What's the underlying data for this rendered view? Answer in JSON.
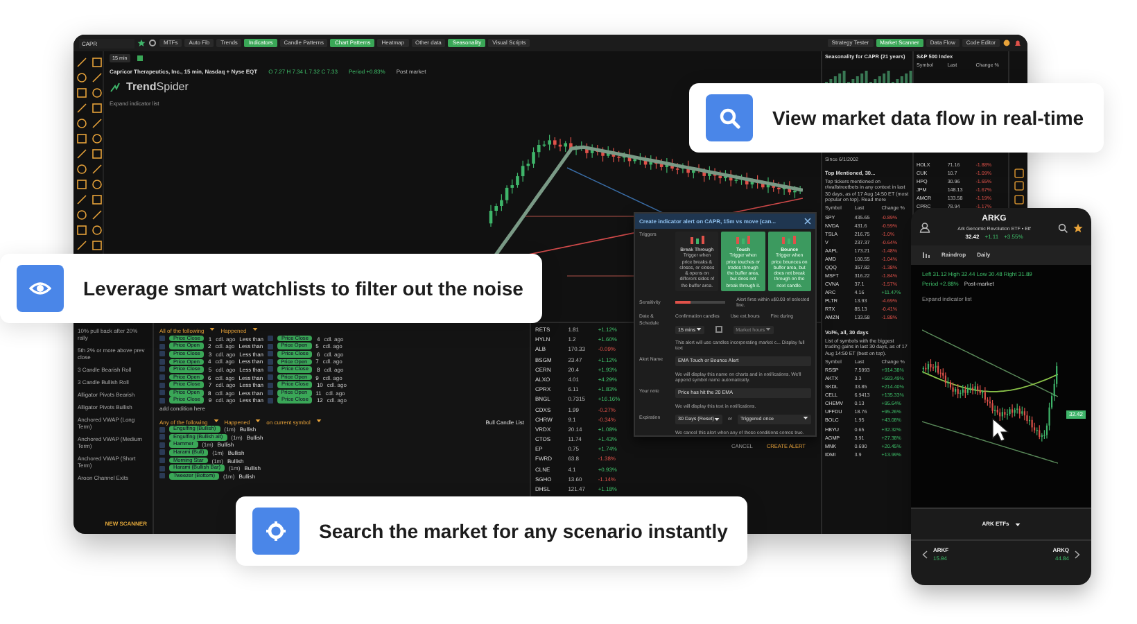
{
  "desktop": {
    "toolbar": {
      "symbol": "CAPR",
      "left_buttons": [
        {
          "label": "MTFs",
          "on": false
        },
        {
          "label": "Auto Fib",
          "on": false
        },
        {
          "label": "Trends",
          "on": false
        },
        {
          "label": "Indicators",
          "on": true
        },
        {
          "label": "Candle Patterns",
          "on": false
        },
        {
          "label": "Chart Patterns",
          "on": true
        },
        {
          "label": "Heatmap",
          "on": false
        },
        {
          "label": "Other data",
          "on": false
        },
        {
          "label": "Seasonality",
          "on": true
        },
        {
          "label": "Visual Scripts",
          "on": false
        }
      ],
      "right_buttons": [
        {
          "label": "Strategy Tester",
          "on": false
        },
        {
          "label": "Market Scanner",
          "on": true
        },
        {
          "label": "Data Flow",
          "on": false
        },
        {
          "label": "Code Editor",
          "on": false
        }
      ]
    },
    "chart": {
      "timeframe": "15 min",
      "title": "Capricor Therapeutics, Inc., 15 min, Nasdaq + Nyse EQT",
      "ohlc": "O 7.27  H 7.34  L 7.32  C 7.33",
      "period": "Period +0.83%",
      "session": "Post market",
      "logo": "**Trend**Spider",
      "expand_link": "Expand indicator list"
    },
    "scanner_list": [
      {
        "title": "10% pull back after 20% rally"
      },
      {
        "title": "5th 2% or more above prev close"
      },
      {
        "title": "3 Candle Bearish Roll"
      },
      {
        "title": "3 Candle Bullish Roll"
      },
      {
        "title": "Alligator Pivots Bearish"
      },
      {
        "title": "Alligator Pivots Bullish"
      },
      {
        "title": "Anchored VWAP (Long Term)"
      },
      {
        "title": "Anchored VWAP (Medium Term)"
      },
      {
        "title": "Anchored VWAP (Short Term)"
      },
      {
        "title": "Aroon Channel Exits"
      }
    ],
    "new_scanner": "NEW SCANNER",
    "scanner": {
      "group1": {
        "mode": "All of the following",
        "when": "Happened"
      },
      "conditions": [
        {
          "a": "Price Close",
          "a_n": "1",
          "a_ago": "cdl. ago",
          "op": "Less than",
          "b": "Price Close",
          "b_n": "4",
          "b_ago": "cdl. ago"
        },
        {
          "a": "Price Open",
          "a_n": "2",
          "a_ago": "cdl. ago",
          "op": "Less than",
          "b": "Price Open",
          "b_n": "5",
          "b_ago": "cdl. ago"
        },
        {
          "a": "Price Close",
          "a_n": "3",
          "a_ago": "cdl. ago",
          "op": "Less than",
          "b": "Price Close",
          "b_n": "6",
          "b_ago": "cdl. ago"
        },
        {
          "a": "Price Open",
          "a_n": "4",
          "a_ago": "cdl. ago",
          "op": "Less than",
          "b": "Price Open",
          "b_n": "7",
          "b_ago": "cdl. ago"
        },
        {
          "a": "Price Close",
          "a_n": "5",
          "a_ago": "cdl. ago",
          "op": "Less than",
          "b": "Price Close",
          "b_n": "8",
          "b_ago": "cdl. ago"
        },
        {
          "a": "Price Open",
          "a_n": "6",
          "a_ago": "cdl. ago",
          "op": "Less than",
          "b": "Price Open",
          "b_n": "9",
          "b_ago": "cdl. ago"
        },
        {
          "a": "Price Close",
          "a_n": "7",
          "a_ago": "cdl. ago",
          "op": "Less than",
          "b": "Price Close",
          "b_n": "10",
          "b_ago": "cdl. ago"
        },
        {
          "a": "Price Open",
          "a_n": "8",
          "a_ago": "cdl. ago",
          "op": "Less than",
          "b": "Price Open",
          "b_n": "11",
          "b_ago": "cdl. ago"
        },
        {
          "a": "Price Close",
          "a_n": "9",
          "a_ago": "cdl. ago",
          "op": "Less than",
          "b": "Price Close",
          "b_n": "12",
          "b_ago": "cdl. ago"
        }
      ],
      "add_condition": "add condition here",
      "group2": {
        "mode": "Any of the following",
        "when": "Happened",
        "scope": "on current symbol",
        "list": "Bull Candle List"
      },
      "patterns": [
        {
          "name": "Engulfing (Bullish)",
          "tf": "(1m)",
          "dir": "Bullish"
        },
        {
          "name": "Engulfing (Bullish alt)",
          "tf": "(1m)",
          "dir": "Bullish"
        },
        {
          "name": "Hammer",
          "tf": "(1m)",
          "dir": "Bullish"
        },
        {
          "name": "Harami (Bull)",
          "tf": "(1m)",
          "dir": "Bullish"
        },
        {
          "name": "Morning Star",
          "tf": "(1m)",
          "dir": "Bullish"
        },
        {
          "name": "Harami (Bullish Bar)",
          "tf": "(1m)",
          "dir": "Bullish"
        },
        {
          "name": "Tweezer (Bottom)",
          "tf": "(1m)",
          "dir": "Bullish"
        }
      ]
    },
    "watchlist": [
      {
        "symbol": "RETS",
        "last": "1.81",
        "change": "+1.12%",
        "up": true
      },
      {
        "symbol": "HYLN",
        "last": "1.2",
        "change": "+1.60%",
        "up": true
      },
      {
        "symbol": "ALB",
        "last": "170.33",
        "change": "-0.09%",
        "up": false
      },
      {
        "symbol": "BSGM",
        "last": "23.47",
        "change": "+1.12%",
        "up": true
      },
      {
        "symbol": "CERN",
        "last": "20.4",
        "change": "+1.93%",
        "up": true
      },
      {
        "symbol": "ALXO",
        "last": "4.01",
        "change": "+4.29%",
        "up": true
      },
      {
        "symbol": "CPRX",
        "last": "6.11",
        "change": "+1.83%",
        "up": true
      },
      {
        "symbol": "BNGL",
        "last": "0.7315",
        "change": "+16.16%",
        "up": true
      },
      {
        "symbol": "CDXS",
        "last": "1.99",
        "change": "-0.27%",
        "up": false
      },
      {
        "symbol": "CHRW",
        "last": "9.1",
        "change": "-0.34%",
        "up": false
      },
      {
        "symbol": "VRDX",
        "last": "20.14",
        "change": "+1.08%",
        "up": true
      },
      {
        "symbol": "CTOS",
        "last": "11.74",
        "change": "+1.43%",
        "up": true
      },
      {
        "symbol": "EP",
        "last": "0.75",
        "change": "+1.74%",
        "up": true
      },
      {
        "symbol": "FWRD",
        "last": "63.8",
        "change": "-1.38%",
        "up": false
      },
      {
        "symbol": "CLNE",
        "last": "4.1",
        "change": "+0.93%",
        "up": true
      },
      {
        "symbol": "SGHO",
        "last": "13.60",
        "change": "-1.14%",
        "up": false
      },
      {
        "symbol": "DHSL",
        "last": "121.47",
        "change": "+1.18%",
        "up": true
      }
    ],
    "panel_b": {
      "seasonality_title": "Seasonality for CAPR (21 years)",
      "since": "Since 6/1/2002",
      "top_title": "Top Mentioned, 30...",
      "top_desc": "Top tickers mentioned on r/wallstreetbets in any context in last 30 days, as of 17 Aug 14:50 ET (most popular on top). Read more",
      "columns": [
        "Symbol",
        "Last",
        "Change %"
      ],
      "top_rows": [
        {
          "symbol": "SPY",
          "last": "435.65",
          "change": "-0.89%",
          "up": false
        },
        {
          "symbol": "NVDA",
          "last": "431.6",
          "change": "-0.59%",
          "up": false
        },
        {
          "symbol": "TSLA",
          "last": "216.75",
          "change": "-1.0%",
          "up": false
        },
        {
          "symbol": "V",
          "last": "237.37",
          "change": "-0.64%",
          "up": false
        },
        {
          "symbol": "AAPL",
          "last": "173.21",
          "change": "-1.48%",
          "up": false
        },
        {
          "symbol": "AMD",
          "last": "100.55",
          "change": "-1.04%",
          "up": false
        },
        {
          "symbol": "QQQ",
          "last": "357.82",
          "change": "-1.38%",
          "up": false
        },
        {
          "symbol": "MSFT",
          "last": "316.22",
          "change": "-1.84%",
          "up": false
        },
        {
          "symbol": "CVNA",
          "last": "37.1",
          "change": "-1.57%",
          "up": false
        },
        {
          "symbol": "ARC",
          "last": "4.16",
          "change": "+11.47%",
          "up": true
        },
        {
          "symbol": "PLTR",
          "last": "13.93",
          "change": "-4.69%",
          "up": false
        },
        {
          "symbol": "RTX",
          "last": "85.13",
          "change": "-0.41%",
          "up": false
        },
        {
          "symbol": "AMZN",
          "last": "133.58",
          "change": "-1.88%",
          "up": false
        }
      ],
      "vol_title": "Vol%, all, 30 days",
      "vol_columns": [
        "Symbol",
        "Last",
        "Change %"
      ],
      "vol_desc": "List of symbols with the biggest trading gains in last 30 days, as of 17 Aug 14:50 ET (best on top).",
      "vol_rows": [
        {
          "symbol": "RSSP",
          "last": "7.5993",
          "change": "+914.38%",
          "up": true
        },
        {
          "symbol": "AKTX",
          "last": "3.3",
          "change": "+583.49%",
          "up": true
        },
        {
          "symbol": "SKDL",
          "last": "33.85",
          "change": "+214.40%",
          "up": true
        },
        {
          "symbol": "CELL",
          "last": "6.9413",
          "change": "+135.33%",
          "up": true
        },
        {
          "symbol": "CHEMV",
          "last": "0.13",
          "change": "+95.64%",
          "up": true
        },
        {
          "symbol": "UFFDU",
          "last": "18.76",
          "change": "+95.26%",
          "up": true
        },
        {
          "symbol": "BOLC",
          "last": "1.95",
          "change": "+43.08%",
          "up": true
        },
        {
          "symbol": "HBYU",
          "last": "0.65",
          "change": "+32.32%",
          "up": true
        },
        {
          "symbol": "AGMP",
          "last": "3.91",
          "change": "+27.38%",
          "up": true
        },
        {
          "symbol": "MNK",
          "last": "0.690",
          "change": "+20.45%",
          "up": true
        },
        {
          "symbol": "IDMI",
          "last": "3.9",
          "change": "+13.99%",
          "up": true
        }
      ]
    },
    "panel_c": {
      "title": "S&P 500 Index",
      "columns": [
        "Symbol",
        "Last",
        "Change %"
      ],
      "rows": [
        {
          "symbol": "HOLX",
          "last": "71.16",
          "change": "-1.88%",
          "up": false
        },
        {
          "symbol": "CUK",
          "last": "10.7",
          "change": "-1.09%",
          "up": false
        },
        {
          "symbol": "HPQ",
          "last": "30.96",
          "change": "-1.65%",
          "up": false
        },
        {
          "symbol": "JPM",
          "last": "148.13",
          "change": "-1.67%",
          "up": false
        },
        {
          "symbol": "AMCR",
          "last": "133.58",
          "change": "-1.19%",
          "up": false
        },
        {
          "symbol": "CPRC",
          "last": "78.94",
          "change": "-1.17%",
          "up": false
        }
      ]
    }
  },
  "alert_dialog": {
    "title": "Create indicator alert on CAPR, 15m vs move (can...",
    "triggers_label": "Triggers",
    "triggers": [
      {
        "name": "Break Through",
        "desc": "Trigger when price breaks & closes, or closes & opens on different sides of the buffer area.",
        "selected": false
      },
      {
        "name": "Touch",
        "desc": "Trigger when price touches or trades through the buffer area, but does not break through it.",
        "selected": true
      },
      {
        "name": "Bounce",
        "desc": "Trigger when price bounces on buffer area, but does not break through on the next candle.",
        "selected": true
      }
    ],
    "sensitivity_label": "Sensitivity",
    "sensitivity": {
      "level": 0.3
    },
    "sensitivity_note": "Alert fires within ±$0.03 of selected line.",
    "schedule_label": "Date & Schedule",
    "confirm_label": "Confirmation candles",
    "confirm_value": "15 mins",
    "ext_label": "Use ext.hours",
    "ext_checked": false,
    "fire_label": "Fire during",
    "fire_value": "Market hours",
    "schedule_note": "This alert will use candles incorporating market c...  Display full text",
    "name_label": "Alert Name",
    "name_value": "EMA Touch or Bounce Alert",
    "name_note": "We will display this name on charts and in notifications. We'll append symbol name automatically.",
    "note_label": "Your note",
    "note_value": "Price has hit the 20 EMA",
    "note_note": "We will display this text in notifications.",
    "expiration_label": "Expiration",
    "expiration_value": "30 Days (Reset)",
    "or": "or",
    "expiration_value2": "Triggered once",
    "expiration_note": "We cancel this alert when any of these conditions comes true.",
    "buttons": [
      {
        "label": "CANCEL",
        "kind": "secondary"
      },
      {
        "label": "CREATE ALERT",
        "kind": "primary"
      }
    ]
  },
  "phone": {
    "symbol": "ARKG",
    "name": "Ark Genomic Revolution ETF • Etf",
    "price": "32.42",
    "change": "+1.11",
    "change_pct": "+3.55%",
    "style": "Raindrop",
    "interval": "Daily",
    "stats": "Left 31.12  High 32.44  Low 30.48  Right 31.89",
    "period": "Period +2.88%",
    "session": "Post-market",
    "expand_link": "Expand indicator list",
    "price_tag": "32.42",
    "list": "ARK ETFs",
    "prev": {
      "symbol": "ARKF",
      "last": "15.94"
    },
    "next": {
      "symbol": "ARKQ",
      "last": "44.84"
    }
  },
  "callouts": [
    {
      "text": "View market data flow in real-time"
    },
    {
      "text": "Leverage smart watchlists to filter out the noise"
    },
    {
      "text": "Search the market for any scenario instantly"
    }
  ]
}
